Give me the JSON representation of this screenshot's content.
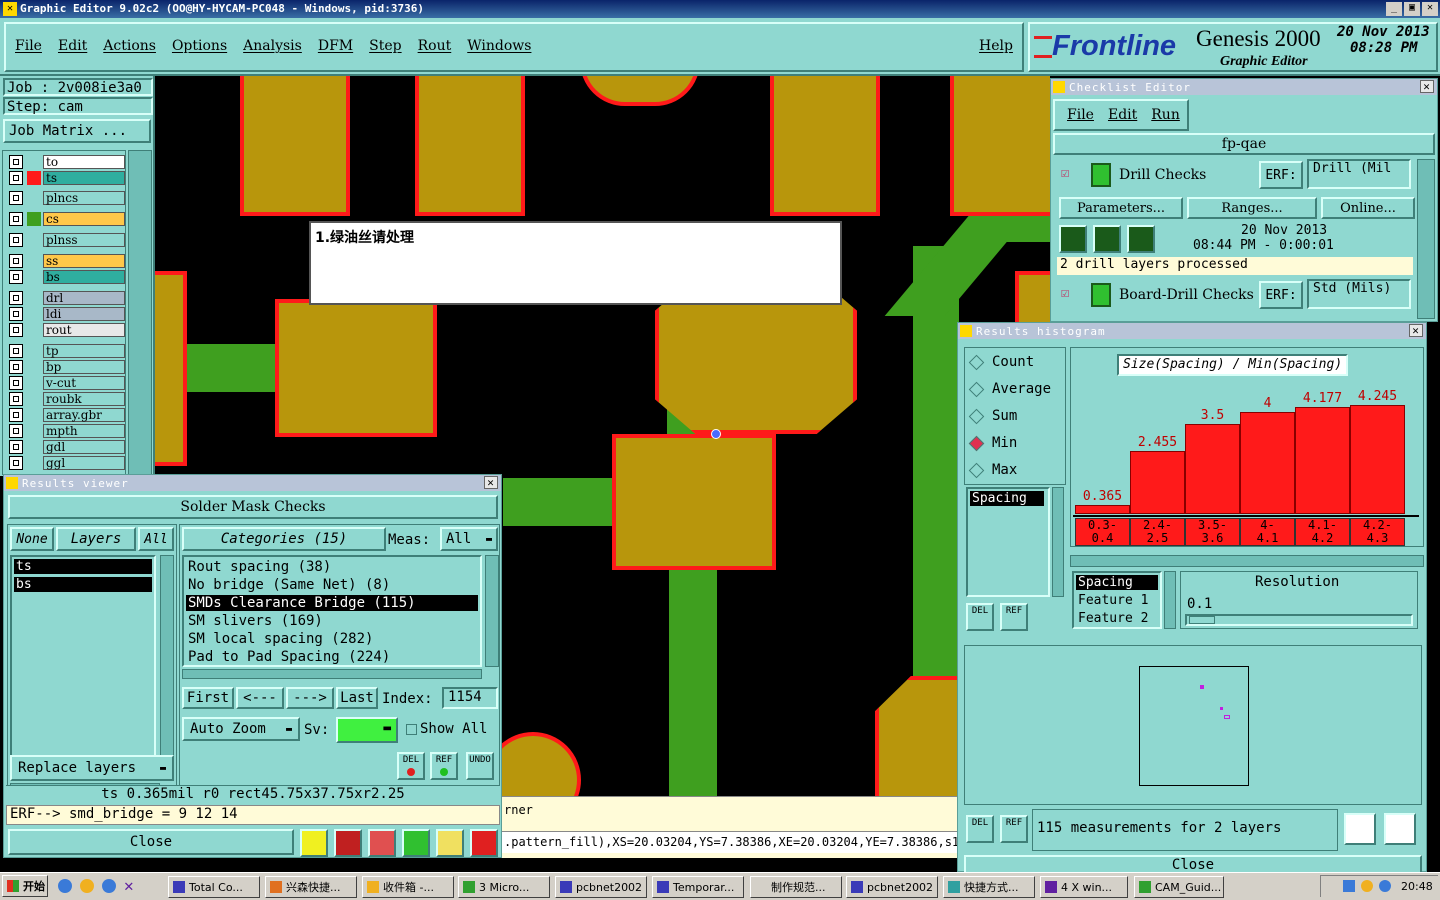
{
  "window": {
    "title": "Graphic Editor 9.02c2 (OO@HY-HYCAM-PC048 - Windows, pid:3736)",
    "controls": [
      "_",
      "▣",
      "✕"
    ]
  },
  "menu": {
    "items": [
      "File",
      "Edit",
      "Actions",
      "Options",
      "Analysis",
      "DFM",
      "Step",
      "Rout",
      "Windows"
    ],
    "help": "Help"
  },
  "brand": {
    "logo": "Frontline",
    "product": "Genesis 2000",
    "subtitle": "Graphic Editor",
    "date": "20 Nov 2013",
    "time": "08:28 PM"
  },
  "job": {
    "job_label": "Job : 2v008ie3a0",
    "step_label": "Step: cam",
    "matrix_button": "Job Matrix ..."
  },
  "layers": [
    {
      "name": "to",
      "color": "#ffffff"
    },
    {
      "name": "ts",
      "color": "#2fae9f",
      "swatch": "#ff1a1a"
    },
    {
      "name": "plncs",
      "color": "#8fd8d0"
    },
    {
      "name": "cs",
      "color": "#ffc84a",
      "swatch": "#3f9f1f"
    },
    {
      "name": "plnss",
      "color": "#8fd8d0"
    },
    {
      "name": "ss",
      "color": "#ffc84a"
    },
    {
      "name": "bs",
      "color": "#2fae9f"
    },
    {
      "name": "drl",
      "color": "#a8b8c8"
    },
    {
      "name": "ldi",
      "color": "#a8b8c8"
    },
    {
      "name": "rout",
      "color": "#e8e8e8"
    },
    {
      "name": "tp",
      "color": "#8fd8d0"
    },
    {
      "name": "bp",
      "color": "#8fd8d0"
    },
    {
      "name": "v-cut",
      "color": "#8fd8d0"
    },
    {
      "name": "roubk",
      "color": "#8fd8d0"
    },
    {
      "name": "array.gbr",
      "color": "#8fd8d0"
    },
    {
      "name": "mpth",
      "color": "#8fd8d0"
    },
    {
      "name": "gdl",
      "color": "#8fd8d0"
    },
    {
      "name": "ggl",
      "color": "#8fd8d0"
    }
  ],
  "note_box": {
    "text": "1.绿油丝请处理"
  },
  "results_viewer": {
    "title": "Results viewer",
    "header": "Solder Mask Checks",
    "filters": [
      "None",
      "Layers",
      "All"
    ],
    "layers": [
      "ts",
      "bs"
    ],
    "categories_label": "Categories (15)",
    "meas_label": "Meas:",
    "meas_value": "All",
    "categories": [
      "Rout spacing (38)",
      "No bridge (Same Net) (8)",
      "SMDs Clearance Bridge (115)",
      "SM slivers (169)",
      "SM local spacing (282)",
      "Pad to Pad Spacing (224)"
    ],
    "selected_category": 2,
    "nav": {
      "first": "First",
      "prev": "<---",
      "next": "--->",
      "last": "Last",
      "index_label": "Index:",
      "index_value": "1154"
    },
    "auto_zoom": "Auto Zoom",
    "sv_label": "Sv:",
    "show_all": "Show All",
    "replace_layers": "Replace layers",
    "icon_buttons": [
      "DEL",
      "REF",
      "UNDO"
    ],
    "status_line": "ts 0.365mil  r0  rect45.75x37.75xr2.25",
    "erf_line": "ERF--> smd_bridge = 9 12 14",
    "close": "Close"
  },
  "status_bar": {
    "line1": "rner",
    "line2": ".pattern_fill),XS=20.03204,YS=7.38386,XE=20.03204,YE=7.38386,s10"
  },
  "checklist": {
    "title": "Checklist Editor",
    "menu": [
      "File",
      "Edit",
      "Run"
    ],
    "name": "fp-qae",
    "items": [
      {
        "name": "Drill Checks",
        "erf_label": "ERF:",
        "erf_value": "Drill (Mil",
        "checked": true
      },
      {
        "name": "Board-Drill Checks",
        "erf_label": "ERF:",
        "erf_value": "Std (Mils)",
        "checked": true
      }
    ],
    "buttons": [
      "Parameters...",
      "Ranges...",
      "Online..."
    ],
    "run_date": "20 Nov 2013",
    "run_time": "08:44 PM - 0:00:01",
    "message": "2 drill layers processed"
  },
  "histogram": {
    "title": "Results histogram",
    "modes": [
      "Count",
      "Average",
      "Sum",
      "Min",
      "Max"
    ],
    "selected_mode": "Min",
    "measure_list": [
      "Spacing"
    ],
    "chart_title": "Size(Spacing) / Min(Spacing)",
    "bottom_list": [
      "Spacing",
      "Feature 1",
      "Feature 2"
    ],
    "resolution_label": "Resolution",
    "resolution_value": "0.1",
    "summary": "115 measurements for 2 layers",
    "close": "Close"
  },
  "chart_data": {
    "type": "bar",
    "title": "Size(Spacing) / Min(Spacing)",
    "categories": [
      "0.3-0.4",
      "2.4-2.5",
      "3.5-3.6",
      "4-4.1",
      "4.1-4.2",
      "4.2-4.3"
    ],
    "bin_labels_line1": [
      "0.3-",
      "2.4-",
      "3.5-",
      "4-",
      "4.1-",
      "4.2-"
    ],
    "bin_labels_line2": [
      "0.4",
      "2.5",
      "3.6",
      "4.1",
      "4.2",
      "4.3"
    ],
    "values": [
      0.365,
      2.455,
      3.5,
      4,
      4.177,
      4.245
    ],
    "value_labels": [
      "0.365",
      "2.455",
      "3.5",
      "4",
      "4.177",
      "4.245"
    ],
    "ylim": [
      0,
      4.3
    ]
  },
  "taskbar": {
    "start": "开始",
    "items": [
      "Total Co...",
      "兴森快捷...",
      "收件箱 -...",
      "3 Micro...",
      "pcbnet2002",
      "Temporar...",
      "制作规范...",
      "pcbnet2002",
      "快捷方式...",
      "4 X win...",
      "CAM_Guid..."
    ],
    "clock": "20:48"
  }
}
